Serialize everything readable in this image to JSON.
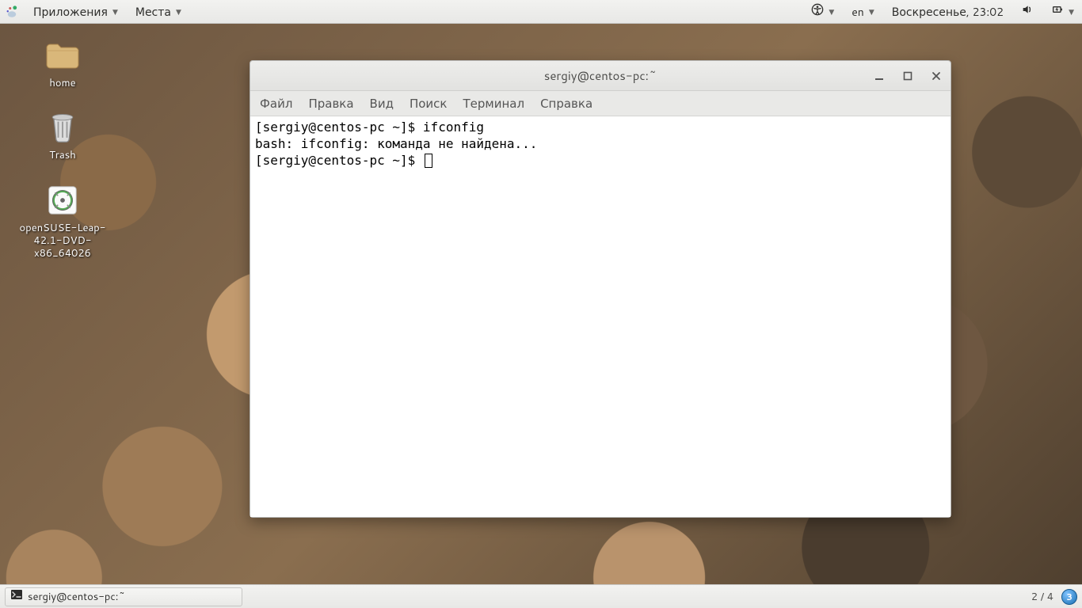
{
  "panel": {
    "apps_label": "Приложения",
    "places_label": "Места",
    "lang": "en",
    "clock": "Воскресенье, 23:02"
  },
  "desktop": {
    "home": "home",
    "trash": "Trash",
    "iso": "openSUSE-Leap-42.1-DVD-x86_64026"
  },
  "terminal": {
    "title": "sergiy@centos-pc:~",
    "menus": {
      "file": "Файл",
      "edit": "Правка",
      "view": "Вид",
      "search": "Поиск",
      "terminal": "Терминал",
      "help": "Справка"
    },
    "line1": "[sergiy@centos-pc ~]$ ifconfig",
    "line2": "bash: ifconfig: команда не найдена...",
    "line3": "[sergiy@centos-pc ~]$ "
  },
  "taskbar": {
    "active_window": "sergiy@centos-pc:~",
    "workspace": "2 / 4",
    "badge": "3"
  }
}
